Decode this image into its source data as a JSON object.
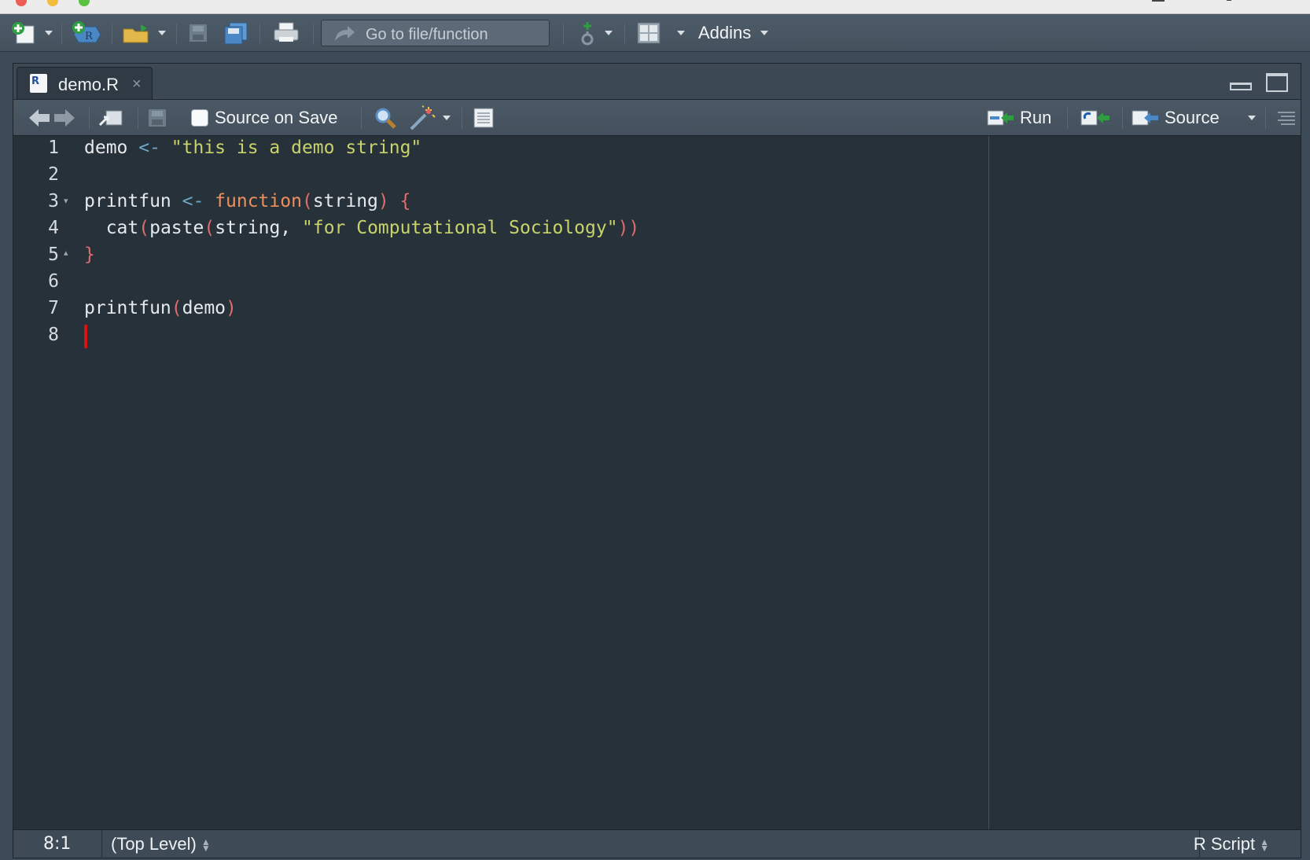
{
  "global_toolbar": {
    "goto_placeholder": "Go to file/function",
    "addins_label": "Addins"
  },
  "editor": {
    "tab": {
      "label": "demo.R",
      "icon_letter": "R"
    },
    "source_on_save_label": "Source on Save",
    "source_on_save_checked": false,
    "run_label": "Run",
    "source_label": "Source",
    "lines": [
      {
        "n": "1",
        "fold": ""
      },
      {
        "n": "2",
        "fold": ""
      },
      {
        "n": "3",
        "fold": "▾"
      },
      {
        "n": "4",
        "fold": ""
      },
      {
        "n": "5",
        "fold": "▴"
      },
      {
        "n": "6",
        "fold": ""
      },
      {
        "n": "7",
        "fold": ""
      },
      {
        "n": "8",
        "fold": ""
      }
    ],
    "code": {
      "l1_id": "demo",
      "l1_op": " <- ",
      "l1_str": "\"this is a demo string\"",
      "l3_id": "printfun",
      "l3_op": " <- ",
      "l3_kw": "function",
      "l3_p1": "(",
      "l3_arg": "string",
      "l3_p2": ")",
      "l3_brace": " {",
      "l4_indent": "  ",
      "l4_f1": "cat",
      "l4_p1": "(",
      "l4_f2": "paste",
      "l4_p2": "(",
      "l4_arg": "string, ",
      "l4_str": "\"for Computational Sociology\"",
      "l4_p3": "))",
      "l5_brace": "}",
      "l7_f": "printfun",
      "l7_p1": "(",
      "l7_arg": "demo",
      "l7_p2": ")"
    }
  },
  "status": {
    "position": "8:1",
    "scope": "(Top Level)",
    "file_type": "R Script"
  },
  "colors": {
    "editor_bg": "#263139",
    "string": "#c9d36a",
    "keyword": "#ef8e5d",
    "paren": "#e06c6c",
    "operator": "#6ea8c9",
    "cursor": "#d91313"
  }
}
